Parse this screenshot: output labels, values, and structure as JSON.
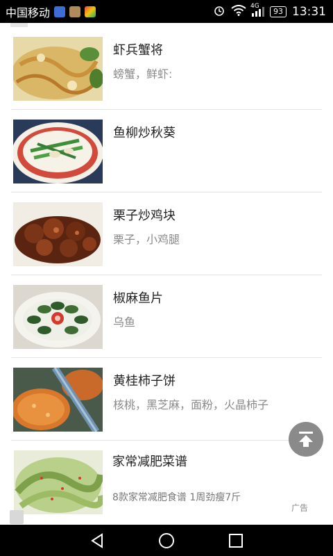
{
  "status_bar": {
    "carrier": "中国移动",
    "network": "4G",
    "battery": "93",
    "time": "13:31"
  },
  "recipes": [
    {
      "title": "虾兵蟹将",
      "ingredients": "螃蟹，鲜虾:"
    },
    {
      "title": "鱼柳炒秋葵",
      "ingredients": ""
    },
    {
      "title": "栗子炒鸡块",
      "ingredients": "栗子，小鸡腿"
    },
    {
      "title": "椒麻鱼片",
      "ingredients": "乌鱼"
    },
    {
      "title": "黄桂柿子饼",
      "ingredients": "核桃，黑芝麻，面粉，火晶柿子"
    }
  ],
  "ad": {
    "title": "家常减肥菜谱",
    "description": "8款家常减肥食谱 1周劲瘦7斤",
    "tag": "广告"
  },
  "icons": {
    "back_to_top": "back-to-top-icon",
    "nav_back": "back-icon",
    "nav_home": "home-icon",
    "nav_recent": "recent-apps-icon"
  },
  "colors": {
    "status_bar": "#000000",
    "divider": "#e2e2e2",
    "back_to_top_bg": "#8a8a8a"
  }
}
